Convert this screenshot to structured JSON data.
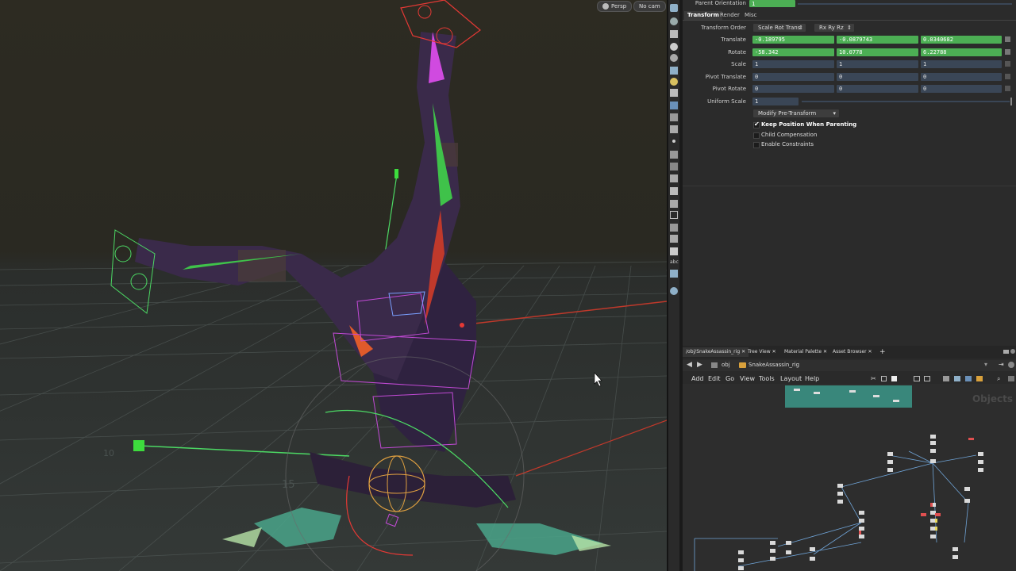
{
  "viewport": {
    "camera_mode_label": "Persp",
    "camera_label": "No cam"
  },
  "params": {
    "parent_orientation": {
      "label": "Parent Orientation",
      "value": "1"
    },
    "tabs": [
      "Transform",
      "Render",
      "Misc"
    ],
    "transform_order": {
      "label": "Transform Order",
      "value": "Scale Rot Trans",
      "rot_order": "Rx Ry Rz"
    },
    "rows": [
      {
        "label": "Translate",
        "values": [
          "-0.189795",
          "-0.0879743",
          "0.0340682"
        ]
      },
      {
        "label": "Rotate",
        "values": [
          "-58.342",
          "10.0778",
          "6.22788"
        ]
      },
      {
        "label": "Scale",
        "values": [
          "1",
          "1",
          "1"
        ]
      },
      {
        "label": "Pivot Translate",
        "values": [
          "0",
          "0",
          "0"
        ]
      },
      {
        "label": "Pivot Rotate",
        "values": [
          "0",
          "0",
          "0"
        ]
      }
    ],
    "uniform_scale": {
      "label": "Uniform Scale",
      "value": "1"
    },
    "modify_pretransform": "Modify Pre-Transform",
    "checkboxes": [
      {
        "label": "Keep Position When Parenting",
        "checked": true
      },
      {
        "label": "Child Compensation",
        "checked": false
      },
      {
        "label": "Enable Constraints",
        "checked": false
      }
    ]
  },
  "network": {
    "tabs": [
      "/obj/SnakeAssassin_rig",
      "Tree View",
      "Material Palette",
      "Asset Browser"
    ],
    "path_root": "obj",
    "path_node": "SnakeAssassin_rig",
    "menu": [
      "Add",
      "Edit",
      "Go",
      "View",
      "Tools",
      "Layout",
      "Help"
    ],
    "watermark": "Objects"
  },
  "colors": {
    "green_field": "#4cae54",
    "blue_field": "#3a4656",
    "panel_bg": "#2b2b2b"
  }
}
